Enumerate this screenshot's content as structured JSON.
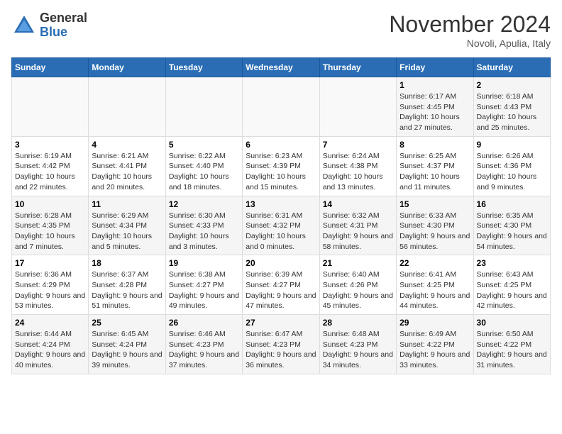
{
  "logo": {
    "general": "General",
    "blue": "Blue"
  },
  "title": "November 2024",
  "subtitle": "Novoli, Apulia, Italy",
  "days_of_week": [
    "Sunday",
    "Monday",
    "Tuesday",
    "Wednesday",
    "Thursday",
    "Friday",
    "Saturday"
  ],
  "weeks": [
    [
      {
        "day": "",
        "detail": ""
      },
      {
        "day": "",
        "detail": ""
      },
      {
        "day": "",
        "detail": ""
      },
      {
        "day": "",
        "detail": ""
      },
      {
        "day": "",
        "detail": ""
      },
      {
        "day": "1",
        "detail": "Sunrise: 6:17 AM\nSunset: 4:45 PM\nDaylight: 10 hours and 27 minutes."
      },
      {
        "day": "2",
        "detail": "Sunrise: 6:18 AM\nSunset: 4:43 PM\nDaylight: 10 hours and 25 minutes."
      }
    ],
    [
      {
        "day": "3",
        "detail": "Sunrise: 6:19 AM\nSunset: 4:42 PM\nDaylight: 10 hours and 22 minutes."
      },
      {
        "day": "4",
        "detail": "Sunrise: 6:21 AM\nSunset: 4:41 PM\nDaylight: 10 hours and 20 minutes."
      },
      {
        "day": "5",
        "detail": "Sunrise: 6:22 AM\nSunset: 4:40 PM\nDaylight: 10 hours and 18 minutes."
      },
      {
        "day": "6",
        "detail": "Sunrise: 6:23 AM\nSunset: 4:39 PM\nDaylight: 10 hours and 15 minutes."
      },
      {
        "day": "7",
        "detail": "Sunrise: 6:24 AM\nSunset: 4:38 PM\nDaylight: 10 hours and 13 minutes."
      },
      {
        "day": "8",
        "detail": "Sunrise: 6:25 AM\nSunset: 4:37 PM\nDaylight: 10 hours and 11 minutes."
      },
      {
        "day": "9",
        "detail": "Sunrise: 6:26 AM\nSunset: 4:36 PM\nDaylight: 10 hours and 9 minutes."
      }
    ],
    [
      {
        "day": "10",
        "detail": "Sunrise: 6:28 AM\nSunset: 4:35 PM\nDaylight: 10 hours and 7 minutes."
      },
      {
        "day": "11",
        "detail": "Sunrise: 6:29 AM\nSunset: 4:34 PM\nDaylight: 10 hours and 5 minutes."
      },
      {
        "day": "12",
        "detail": "Sunrise: 6:30 AM\nSunset: 4:33 PM\nDaylight: 10 hours and 3 minutes."
      },
      {
        "day": "13",
        "detail": "Sunrise: 6:31 AM\nSunset: 4:32 PM\nDaylight: 10 hours and 0 minutes."
      },
      {
        "day": "14",
        "detail": "Sunrise: 6:32 AM\nSunset: 4:31 PM\nDaylight: 9 hours and 58 minutes."
      },
      {
        "day": "15",
        "detail": "Sunrise: 6:33 AM\nSunset: 4:30 PM\nDaylight: 9 hours and 56 minutes."
      },
      {
        "day": "16",
        "detail": "Sunrise: 6:35 AM\nSunset: 4:30 PM\nDaylight: 9 hours and 54 minutes."
      }
    ],
    [
      {
        "day": "17",
        "detail": "Sunrise: 6:36 AM\nSunset: 4:29 PM\nDaylight: 9 hours and 53 minutes."
      },
      {
        "day": "18",
        "detail": "Sunrise: 6:37 AM\nSunset: 4:28 PM\nDaylight: 9 hours and 51 minutes."
      },
      {
        "day": "19",
        "detail": "Sunrise: 6:38 AM\nSunset: 4:27 PM\nDaylight: 9 hours and 49 minutes."
      },
      {
        "day": "20",
        "detail": "Sunrise: 6:39 AM\nSunset: 4:27 PM\nDaylight: 9 hours and 47 minutes."
      },
      {
        "day": "21",
        "detail": "Sunrise: 6:40 AM\nSunset: 4:26 PM\nDaylight: 9 hours and 45 minutes."
      },
      {
        "day": "22",
        "detail": "Sunrise: 6:41 AM\nSunset: 4:25 PM\nDaylight: 9 hours and 44 minutes."
      },
      {
        "day": "23",
        "detail": "Sunrise: 6:43 AM\nSunset: 4:25 PM\nDaylight: 9 hours and 42 minutes."
      }
    ],
    [
      {
        "day": "24",
        "detail": "Sunrise: 6:44 AM\nSunset: 4:24 PM\nDaylight: 9 hours and 40 minutes."
      },
      {
        "day": "25",
        "detail": "Sunrise: 6:45 AM\nSunset: 4:24 PM\nDaylight: 9 hours and 39 minutes."
      },
      {
        "day": "26",
        "detail": "Sunrise: 6:46 AM\nSunset: 4:23 PM\nDaylight: 9 hours and 37 minutes."
      },
      {
        "day": "27",
        "detail": "Sunrise: 6:47 AM\nSunset: 4:23 PM\nDaylight: 9 hours and 36 minutes."
      },
      {
        "day": "28",
        "detail": "Sunrise: 6:48 AM\nSunset: 4:23 PM\nDaylight: 9 hours and 34 minutes."
      },
      {
        "day": "29",
        "detail": "Sunrise: 6:49 AM\nSunset: 4:22 PM\nDaylight: 9 hours and 33 minutes."
      },
      {
        "day": "30",
        "detail": "Sunrise: 6:50 AM\nSunset: 4:22 PM\nDaylight: 9 hours and 31 minutes."
      }
    ]
  ]
}
